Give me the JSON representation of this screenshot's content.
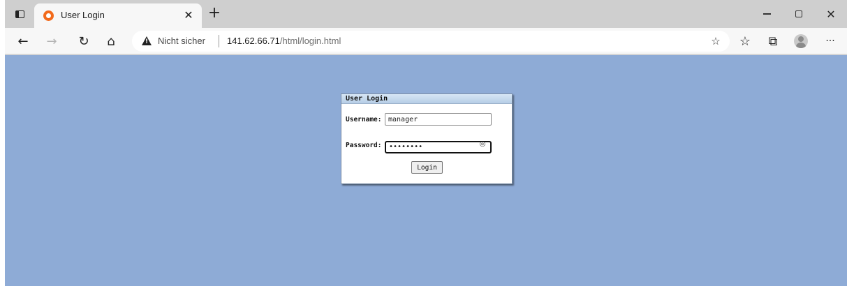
{
  "browser": {
    "tab": {
      "title": "User Login",
      "close_icon": "close-icon"
    },
    "new_tab_symbol": "+",
    "window_controls": {
      "close_symbol": "✕"
    },
    "toolbar": {
      "back_symbol": "←",
      "forward_symbol": "→",
      "reload_symbol": "↻",
      "home_symbol": "⌂",
      "favorites_symbol": "☆",
      "collections_symbol": "⧉",
      "more_symbol": "···"
    },
    "address_bar": {
      "security_text": "Nicht sicher",
      "url_host": "141.62.66.71",
      "url_path": "/html/login.html",
      "add_favorite_symbol": "☆"
    },
    "accent_color": "#f26a1b"
  },
  "page": {
    "background_color": "#8eabd6",
    "login_panel": {
      "title": "User Login",
      "username_label": "Username:",
      "username_value": "manager",
      "password_label": "Password:",
      "password_value": "••••••••",
      "reveal_icon": "eye-icon",
      "submit_label": "Login"
    }
  }
}
